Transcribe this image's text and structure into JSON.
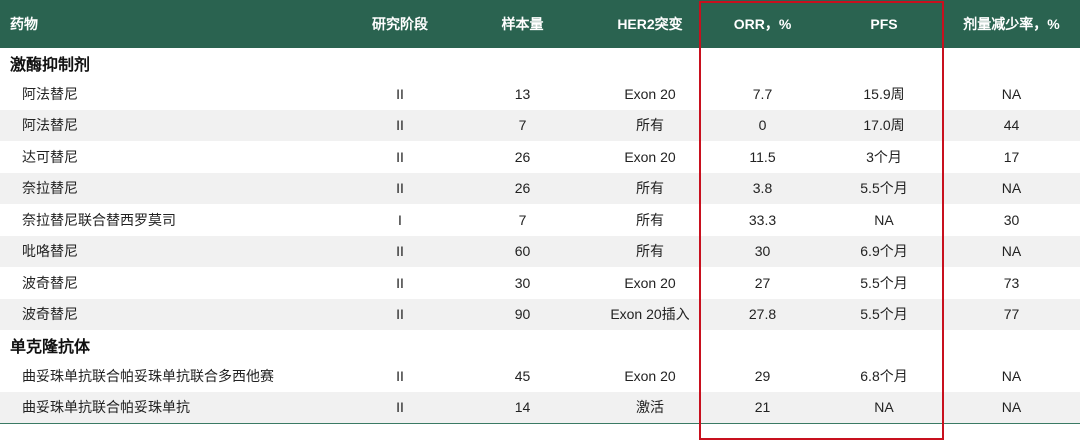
{
  "headers": [
    "药物",
    "研究阶段",
    "样本量",
    "HER2突变",
    "ORR，%",
    "PFS",
    "剂量减少率，%"
  ],
  "sections": [
    {
      "title": "激酶抑制剂",
      "rows": [
        [
          "阿法替尼",
          "II",
          "13",
          "Exon 20",
          "7.7",
          "15.9周",
          "NA"
        ],
        [
          "阿法替尼",
          "II",
          "7",
          "所有",
          "0",
          "17.0周",
          "44"
        ],
        [
          "达可替尼",
          "II",
          "26",
          "Exon 20",
          "11.5",
          "3个月",
          "17"
        ],
        [
          "奈拉替尼",
          "II",
          "26",
          "所有",
          "3.8",
          "5.5个月",
          "NA"
        ],
        [
          "奈拉替尼联合替西罗莫司",
          "I",
          "7",
          "所有",
          "33.3",
          "NA",
          "30"
        ],
        [
          "吡咯替尼",
          "II",
          "60",
          "所有",
          "30",
          "6.9个月",
          "NA"
        ],
        [
          "波奇替尼",
          "II",
          "30",
          "Exon 20",
          "27",
          "5.5个月",
          "73"
        ],
        [
          "波奇替尼",
          "II",
          "90",
          "Exon 20插入",
          "27.8",
          "5.5个月",
          "77"
        ]
      ]
    },
    {
      "title": "单克隆抗体",
      "rows": [
        [
          "曲妥珠单抗联合帕妥珠单抗联合多西他赛",
          "II",
          "45",
          "Exon 20",
          "29",
          "6.8个月",
          "NA"
        ],
        [
          "曲妥珠单抗联合帕妥珠单抗",
          "II",
          "14",
          "激活",
          "21",
          "NA",
          "NA"
        ]
      ]
    }
  ],
  "colors": {
    "header_bg": "#2a6350",
    "highlight_border": "#c8101e",
    "row_alt_bg": "#f1f1f1"
  }
}
